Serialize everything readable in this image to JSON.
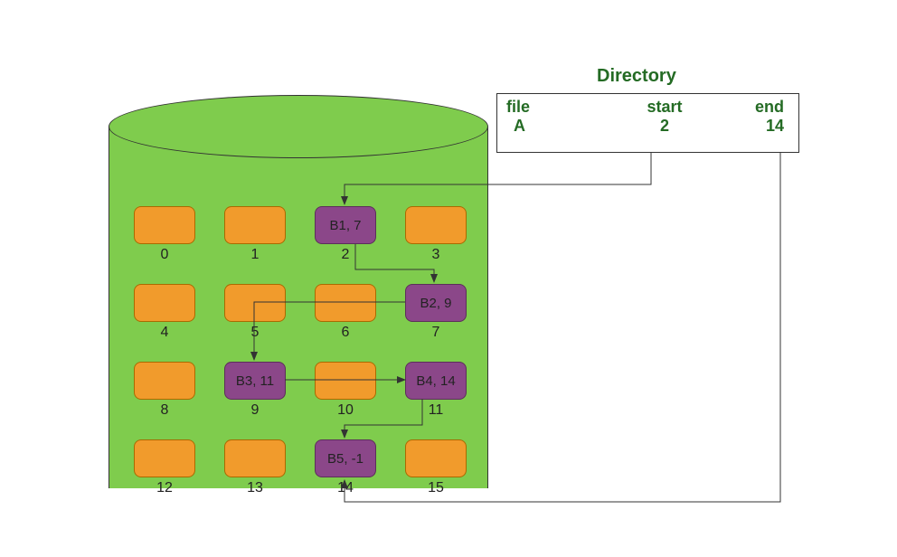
{
  "directory": {
    "title": "Directory",
    "headers": {
      "file": "file",
      "start": "start",
      "end": "end"
    },
    "row": {
      "file": "A",
      "start": "2",
      "end": "14"
    }
  },
  "blocks": [
    {
      "idx": "0"
    },
    {
      "idx": "1"
    },
    {
      "idx": "2",
      "label": "B1, 7",
      "purple": true
    },
    {
      "idx": "3"
    },
    {
      "idx": "4"
    },
    {
      "idx": "5"
    },
    {
      "idx": "6"
    },
    {
      "idx": "7",
      "label": "B2, 9",
      "purple": true
    },
    {
      "idx": "8"
    },
    {
      "idx": "9",
      "label": "B3, 11",
      "purple": true
    },
    {
      "idx": "10"
    },
    {
      "idx": "11",
      "label": "B4, 14",
      "purple": true
    },
    {
      "idx": "12"
    },
    {
      "idx": "13"
    },
    {
      "idx": "14",
      "label": "B5, -1",
      "purple": true
    },
    {
      "idx": "15"
    }
  ],
  "chart_data": {
    "type": "diagram",
    "title": "Linked allocation of disk blocks",
    "directory_entry": {
      "file": "A",
      "start": 2,
      "end": 14
    },
    "disk_blocks_total": 16,
    "file_chain": [
      {
        "block": 2,
        "label": "B1",
        "next": 7
      },
      {
        "block": 7,
        "label": "B2",
        "next": 9
      },
      {
        "block": 9,
        "label": "B3",
        "next": 11
      },
      {
        "block": 11,
        "label": "B4",
        "next": 14
      },
      {
        "block": 14,
        "label": "B5",
        "next": -1
      }
    ],
    "arrows": [
      {
        "from": "directory.start",
        "to": 2
      },
      {
        "from": 2,
        "to": 7
      },
      {
        "from": 7,
        "to": 9,
        "via": 5
      },
      {
        "from": 9,
        "to": 11,
        "via": 10
      },
      {
        "from": 11,
        "to": 14
      },
      {
        "from": "directory.end",
        "to": 14
      }
    ]
  }
}
